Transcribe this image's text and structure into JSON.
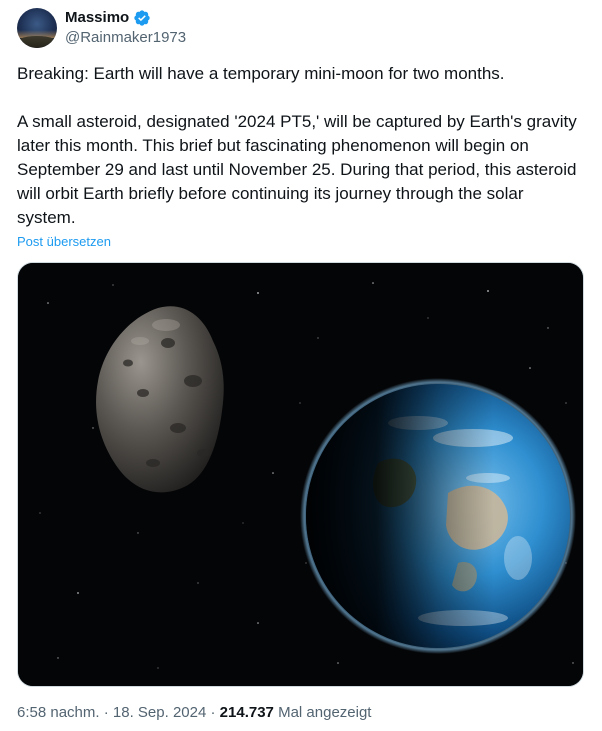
{
  "author": {
    "name": "Massimo",
    "handle": "@Rainmaker1973"
  },
  "icons": {
    "verified": "verified-badge-icon",
    "verified_color": "#1d9bf0"
  },
  "tweet": {
    "paragraph_1": "Breaking: Earth will have a temporary mini-moon for two months.",
    "paragraph_2": "A small asteroid, designated '2024 PT5,' will be captured by Earth's gravity later this month. This brief but fascinating phenomenon will begin on September 29 and last until November 25. During that period, this asteroid will orbit Earth briefly before continuing its journey through the solar system.",
    "translate_label": "Post übersetzen"
  },
  "meta": {
    "time": "6:58 nachm.",
    "sep1": " · ",
    "date": "18. Sep. 2024",
    "sep2": " · ",
    "views_count": "214.737",
    "views_label": " Mal angezeigt"
  },
  "colors": {
    "link": "#1d9bf0",
    "secondary_text": "#536471",
    "primary_text": "#0f1419"
  }
}
